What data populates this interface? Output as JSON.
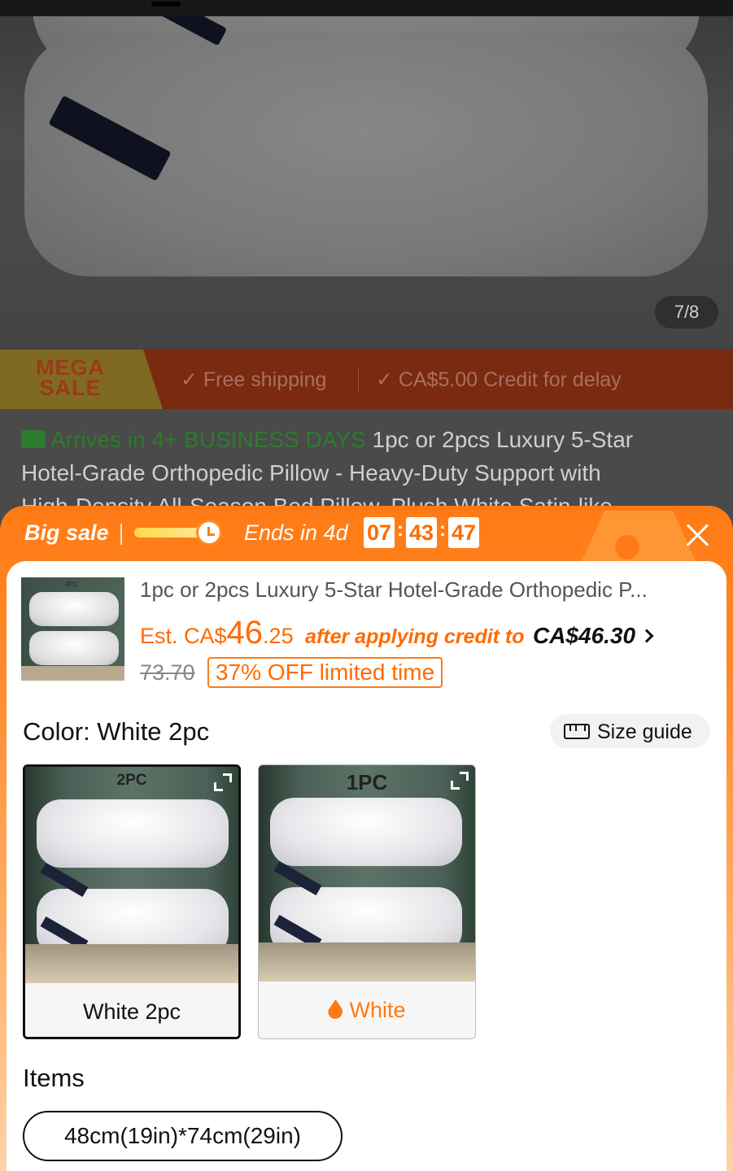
{
  "background": {
    "image_counter": "7/8",
    "promo": {
      "mega_line1": "MEGA",
      "mega_line2": "SALE",
      "perk1": "✓ Free shipping",
      "perk2": "✓ CA$5.00 Credit for delay"
    },
    "arrives": "Arrives in 4+ BUSINESS DAYS",
    "title_line1_rest": "1pc or 2pcs Luxury 5-Star",
    "title_line2": "Hotel-Grade Orthopedic Pillow - Heavy-Duty Support with",
    "title_line3": "High-Density All-Season Bed Pillow, Plush White Satin-like"
  },
  "sale_bar": {
    "big_sale": "Big sale",
    "ends_in": "Ends in 4d",
    "hours": "07",
    "minutes": "43",
    "seconds": "47"
  },
  "product": {
    "thumb_label": "2PC",
    "title": "1pc or 2pcs Luxury 5-Star Hotel-Grade Orthopedic P...",
    "est_prefix": "Est. CA$",
    "est_whole": "46",
    "est_decimal": ".25",
    "after_credit": "after applying credit to",
    "credit_price": "CA$46.30",
    "original_price": "73.70",
    "discount": "37% OFF limited time"
  },
  "options": {
    "color_label": "Color: White 2pc",
    "size_guide": "Size guide",
    "variants": [
      {
        "top_label": "2PC",
        "name": "White 2pc",
        "selected": true
      },
      {
        "top_label": "1PC",
        "name": "White",
        "selected": false
      }
    ],
    "items_label": "Items",
    "size_choice": "48cm(19in)*74cm(29in)"
  },
  "colors": {
    "accent": "#ff7a14",
    "price": "#ff6a00",
    "arrives_green": "#2e7a2e"
  }
}
